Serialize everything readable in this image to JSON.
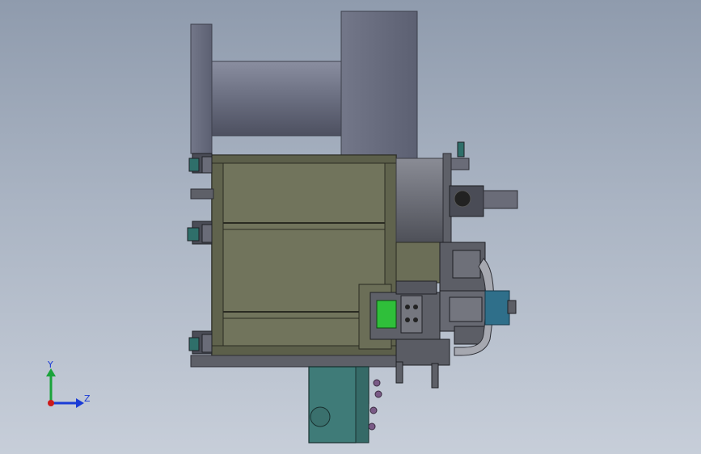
{
  "viewport": {
    "background_top": "#8f9bad",
    "background_bottom": "#c7ced9"
  },
  "triad": {
    "y_label": "Y",
    "z_label": "Z",
    "y_color": "#1aa33a",
    "z_color": "#1a3bd6",
    "origin_color": "#cc1a1a"
  },
  "colors": {
    "drum": "#6d7183",
    "frame": "#6b6e57",
    "plate": "#3f7b78",
    "motor": "#2f6f8a",
    "green_part": "#2fbf3a",
    "bracket": "#5e6068"
  }
}
